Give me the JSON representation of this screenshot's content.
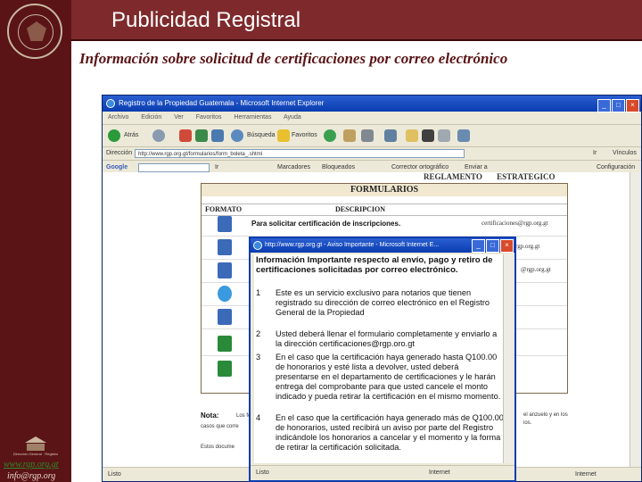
{
  "slide": {
    "title": "Publicidad Registral",
    "subtitle": "Información sobre solicitud de certificaciones por correo electrónico",
    "footer_url": "www.rgp.org.gt",
    "footer_email": "info@rgp.org"
  },
  "colors": {
    "sidebar": "#5a1416",
    "header": "#7e2a2c",
    "subtitle_text": "#5a1416",
    "window_title": "#0a3cb0"
  },
  "browser": {
    "title": "Registro de la Propiedad Guatemala - Microsoft Internet Explorer",
    "menu": [
      "Archivo",
      "Edición",
      "Ver",
      "Favoritos",
      "Herramientas",
      "Ayuda"
    ],
    "toolbar": {
      "back": "Atrás",
      "search": "Búsqueda",
      "favorites": "Favoritos"
    },
    "address_label": "Dirección",
    "address_value": "http://www.rgp.org.gt/formularios/form_boleta_.shtml",
    "links_label": "Vínculos",
    "google_label": "Google",
    "google_items": [
      "Ir",
      "Marcadores",
      "Bloqueados",
      "Corrector ortográfico",
      "Enviar a"
    ],
    "settings_label": "Configuración",
    "go_label": "Ir",
    "status_left": "Listo",
    "status_right": "Internet"
  },
  "page": {
    "reglamento": "REGLAMENTO",
    "estrategico": "ESTRATEGICO",
    "formularios_title": "FORMULARIOS",
    "col_formato": "FORMATO",
    "col_descripcion": "DESCRIPCION",
    "row1_desc": "Para solicitar certificación de inscripciones.",
    "row_emails": [
      "certificaciones@rgp.org.gt",
      "rgp.org.gt",
      "@rgp.org.gt"
    ],
    "nota_label": "Nota:",
    "nota_text": "Los fo",
    "casos_text": "casos que corre",
    "right_text": "el anzuelo y en los",
    "right_text2": "ios.",
    "estos_text": "Estos docume"
  },
  "popup": {
    "title": "http://www.rgp.org.gt - Aviso Importante - Microsoft Internet E...",
    "heading": "Información Importante respecto al envío, pago y retiro de certificaciones solicitadas por correo electrónico.",
    "items": [
      {
        "num": "1",
        "text": "Este es un servicio exclusivo para notarios que tienen registrado su dirección de correo electrónico en el Registro General de la Propiedad"
      },
      {
        "num": "2",
        "text": "Usted deberá llenar el formulario completamente y enviarlo a la dirección certificaciones@rgp.oro.gt"
      },
      {
        "num": "3",
        "text": "En el caso que la certificación haya generado hasta Q100.00 de honorarios y esté lista a devolver, usted deberá presentarse en el departamento de certificaciones y le harán entrega del comprobante para que usted cancele el monto indicado y pueda retirar la certificación en el mismo momento."
      },
      {
        "num": "4",
        "text": "En el caso que la certificación haya generado más de Q100.00 de honorarios, usted recibirá un aviso por parte del Registro indicándole los honorarios a cancelar y el momento y la forma de retirar la certificación solicitada."
      }
    ],
    "status_left": "Listo",
    "status_right": "Internet"
  }
}
